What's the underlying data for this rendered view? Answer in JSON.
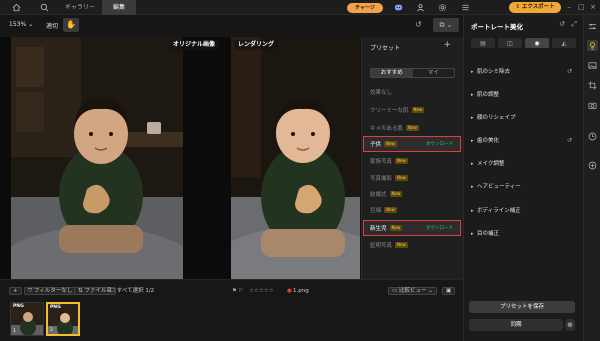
{
  "topbar": {
    "tabs": [
      {
        "label": "ギャラリー"
      },
      {
        "label": "編集"
      }
    ],
    "charge_label": "チャージ",
    "export_label": "エクスポート"
  },
  "toolbar": {
    "zoom": "153%",
    "fit_label": "適切"
  },
  "canvas": {
    "original_label": "オリジナル画像",
    "rendered_label": "レンダリング"
  },
  "presets": {
    "title": "プリセット",
    "tabs": [
      "おすすめ",
      "マイ"
    ],
    "items": [
      {
        "label": "効果なし",
        "new": false,
        "selected": false
      },
      {
        "label": "クリーミーな肌",
        "new": true,
        "selected": false
      },
      {
        "label": "キメのある肌",
        "new": true,
        "selected": false
      },
      {
        "label": "子供",
        "new": true,
        "selected": true,
        "status": "ダウンロード"
      },
      {
        "label": "家族写真",
        "new": true,
        "selected": false
      },
      {
        "label": "写真撮影",
        "new": true,
        "selected": false
      },
      {
        "label": "結婚式",
        "new": true,
        "selected": false
      },
      {
        "label": "巨細",
        "new": true,
        "selected": false
      },
      {
        "label": "新生児",
        "new": true,
        "selected": true,
        "status": "ダウンロード"
      },
      {
        "label": "証明写真",
        "new": true,
        "selected": false
      }
    ],
    "new_badge": "New"
  },
  "bottombar": {
    "filter_label": "フィルターなし",
    "filename_label": "ファイル名",
    "select_all_label": "すべて選択 1/2",
    "file_name": "1.png",
    "compare_label": "比較ビュー",
    "thumbs": [
      {
        "type": "PNG",
        "index": "1",
        "selected": false
      },
      {
        "type": "PNG",
        "index": "2",
        "selected": true
      }
    ]
  },
  "rightpanel": {
    "title": "ポートレート美化",
    "sections": [
      {
        "label": "肌のシミ除去",
        "reset": true
      },
      {
        "label": "肌の調整",
        "reset": false
      },
      {
        "label": "顔のリシェイプ",
        "reset": false
      },
      {
        "label": "歯の美化",
        "reset": true
      },
      {
        "label": "メイク調整",
        "reset": false
      },
      {
        "label": "ヘアビューティー",
        "reset": false
      },
      {
        "label": "ボディライン補正",
        "reset": false
      },
      {
        "label": "目の補正",
        "reset": false
      }
    ],
    "save_preset_label": "プリセットを保存",
    "sync_label": "同期"
  },
  "colors": {
    "accent": "#f2a838",
    "selection_border": "#e23b3b",
    "download_green": "#38c772",
    "thumb_selected": "#f2c02c"
  },
  "icons": [
    "home-icon",
    "search-icon",
    "chevron-down-icon",
    "discord-icon",
    "user-icon",
    "gear-icon",
    "menu-icon",
    "minimize-icon",
    "maximize-icon",
    "close-icon",
    "hand-icon",
    "undo-icon",
    "redo-icon",
    "plus-icon",
    "flag-icon",
    "star-icon",
    "color-dot-icon",
    "reset-icon",
    "adjust-icon",
    "portrait-icon",
    "crop-icon",
    "camera-icon",
    "history-icon",
    "add-icon"
  ]
}
